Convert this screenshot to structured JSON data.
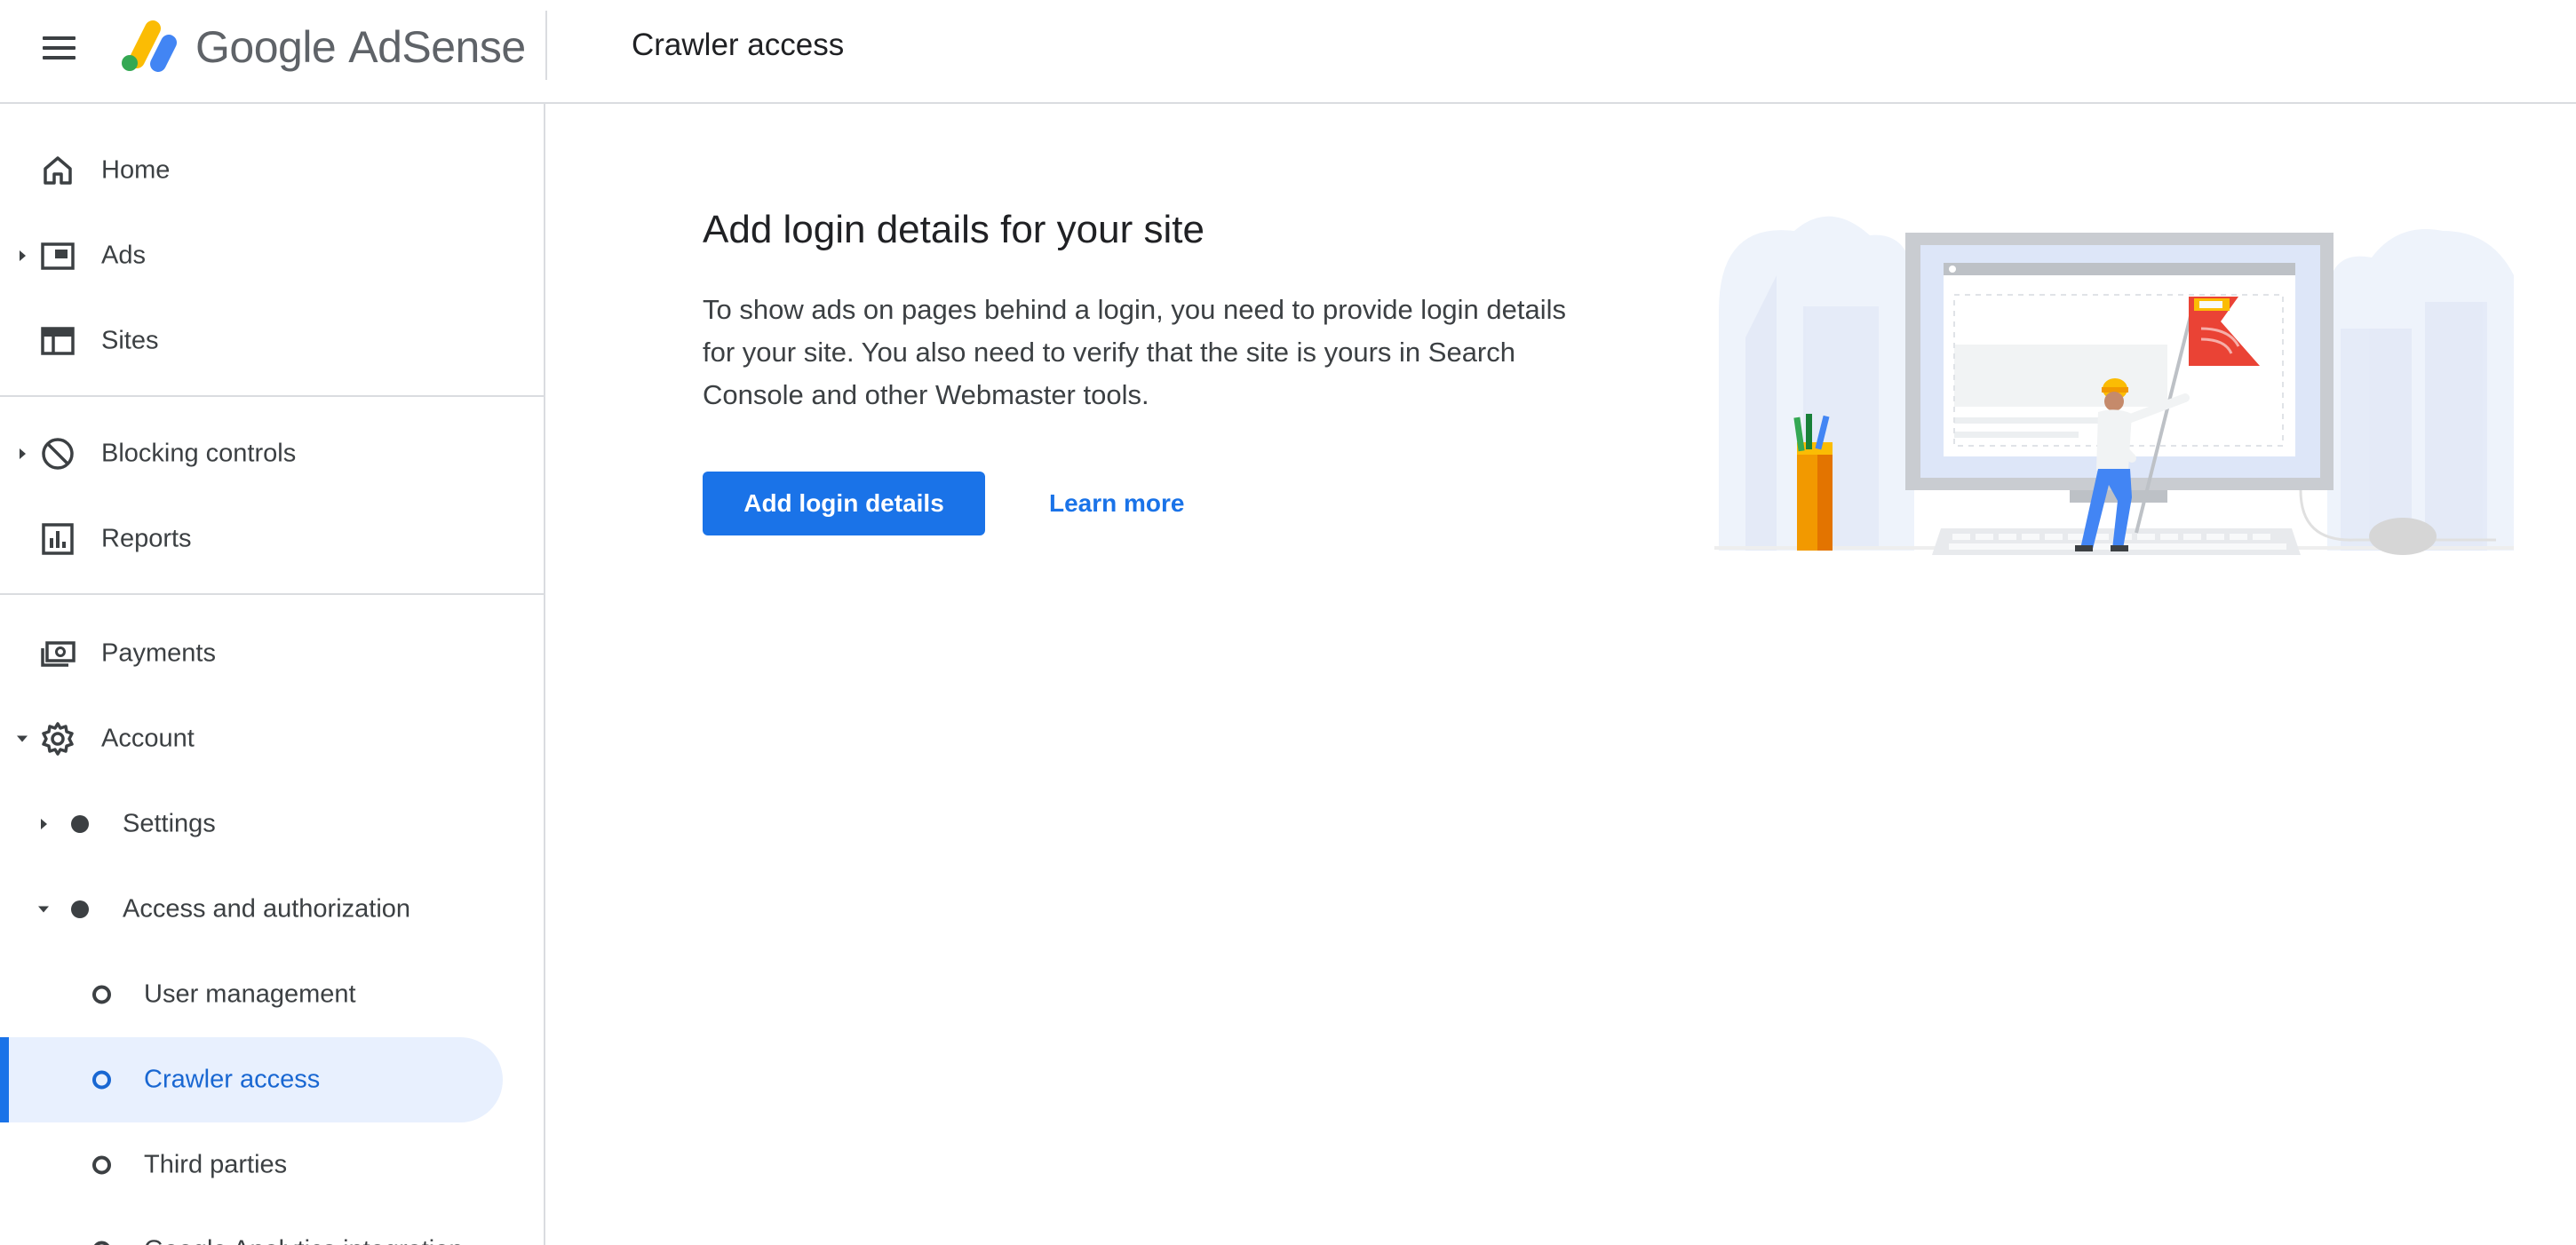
{
  "header": {
    "brand_google": "Google",
    "brand_product": "AdSense",
    "page_title": "Crawler access"
  },
  "sidebar": {
    "items": [
      {
        "label": "Home",
        "icon": "home-icon"
      },
      {
        "label": "Ads",
        "icon": "ads-icon"
      },
      {
        "label": "Sites",
        "icon": "sites-icon"
      },
      {
        "label": "Blocking controls",
        "icon": "block-icon"
      },
      {
        "label": "Reports",
        "icon": "reports-icon"
      },
      {
        "label": "Payments",
        "icon": "payments-icon"
      },
      {
        "label": "Account",
        "icon": "gear-icon"
      },
      {
        "label": "Settings"
      },
      {
        "label": "Access and authorization"
      },
      {
        "label": "User management"
      },
      {
        "label": "Crawler access"
      },
      {
        "label": "Third parties"
      },
      {
        "label": "Google Analytics integration"
      }
    ],
    "active_item": "Crawler access"
  },
  "main": {
    "title": "Add login details for your site",
    "description": "To show ads on pages behind a login, you need to provide login details for your site. You also need to verify that the site is yours in Search Console and other Webmaster tools.",
    "primary_button": "Add login details",
    "secondary_link": "Learn more"
  },
  "colors": {
    "accent": "#1a73e8",
    "active_bg": "#e8f0fe",
    "active_text": "#1967d2",
    "text": "#3c4043",
    "divider": "#dadce0"
  }
}
